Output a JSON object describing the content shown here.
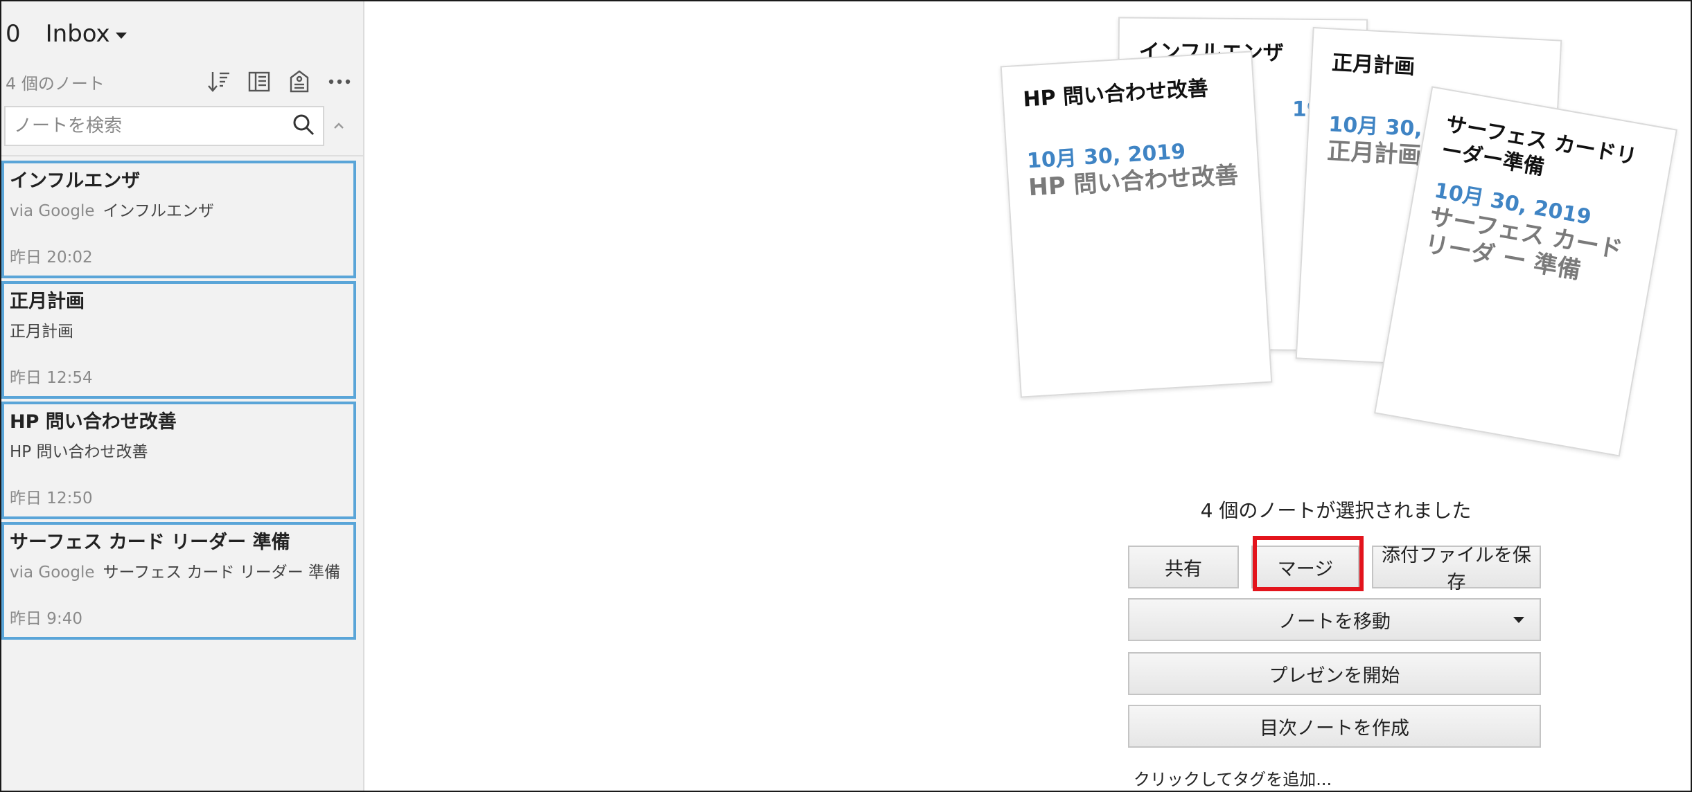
{
  "notebook": {
    "count": "0",
    "name": "Inbox"
  },
  "list": {
    "note_count": "4 個のノート",
    "search_placeholder": "ノートを検索",
    "toolbar_icons": [
      "sort-icon",
      "view-toggle-icon",
      "reminder-tag-icon",
      "more-options-icon"
    ]
  },
  "notes": [
    {
      "title": "インフルエンザ",
      "via": "via Google",
      "snippet": "インフルエンザ",
      "date": "昨日 20:02"
    },
    {
      "title": "正月計画",
      "via": "",
      "snippet": "正月計画",
      "date": "昨日 12:54"
    },
    {
      "title": "HP 問い合わせ改善",
      "via": "",
      "snippet": "HP 問い合わせ改善",
      "date": "昨日 12:50"
    },
    {
      "title": "サーフェス カード リーダー 準備",
      "via": "via Google",
      "snippet": "サーフェス カード リーダー 準備",
      "date": "昨日 9:40"
    }
  ],
  "stack": {
    "papers": [
      {
        "title": "インフルエンザ",
        "date": "",
        "body": ""
      },
      {
        "title": "正月計画",
        "date": "10月 30, 2",
        "body": "正月計画"
      },
      {
        "title": "HP 問い合わせ改善",
        "date": "10月 30, 2019",
        "body": "HP 問い合わせ改善"
      },
      {
        "title": "サーフェス カードリーダー準備",
        "date": "10月 30, 2019",
        "body": "サーフェス カードリーダ ー 準備"
      }
    ],
    "peek_fragment": "19"
  },
  "selection": {
    "label": "4 個のノートが選択されました"
  },
  "actions": {
    "share": "共有",
    "merge": "マージ",
    "save_attachments": "添付ファイルを保存",
    "move_note": "ノートを移動",
    "start_presentation": "プレゼンを開始",
    "create_toc": "目次ノートを作成",
    "add_tag": "クリックしてタグを追加..."
  },
  "colors": {
    "selection_border": "#5aa5d8",
    "highlight": "#e3141c",
    "date_blue": "#3f84c4"
  }
}
